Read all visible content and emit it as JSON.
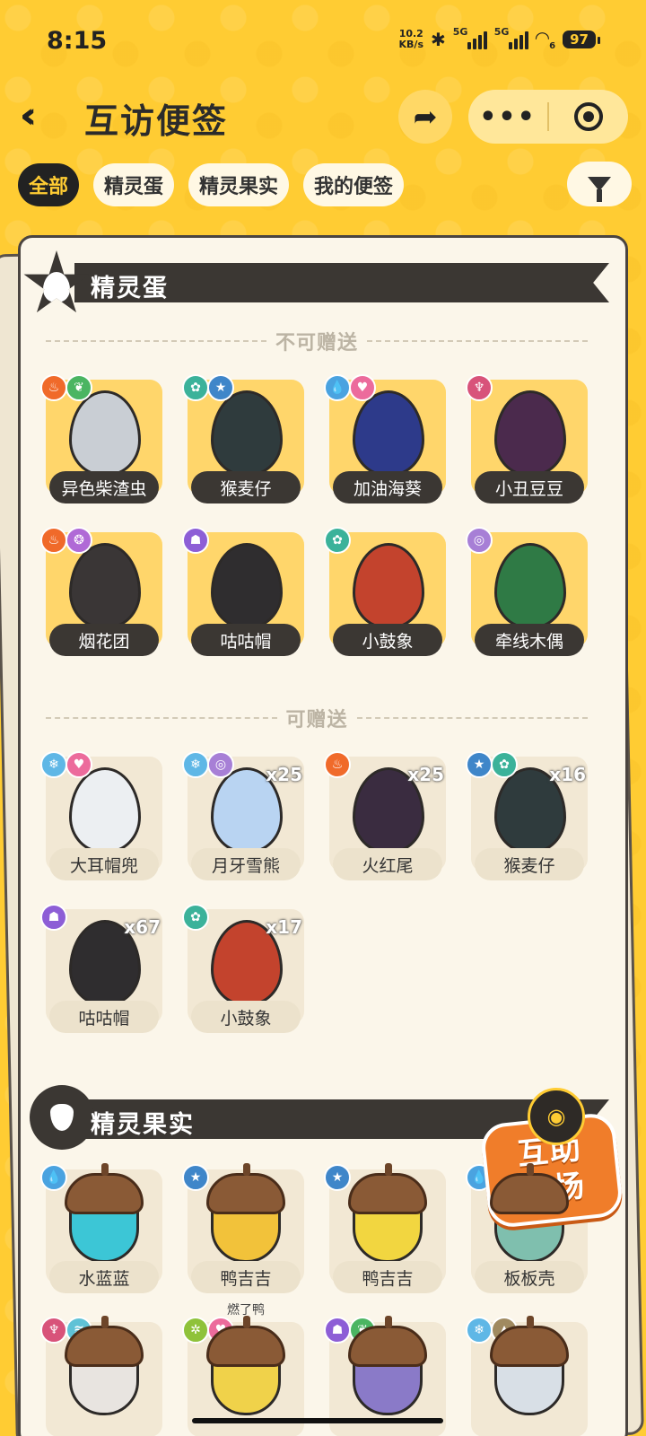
{
  "status_bar": {
    "time": "8:15",
    "net_speed_value": "10.2",
    "net_speed_unit": "KB/s",
    "network_1": "5G",
    "network_2": "5G",
    "wifi_sub": "6",
    "battery": "97"
  },
  "header": {
    "title": "互访便签",
    "back_icon": "double-chevron-left-icon",
    "share_icon": "share-arrow-icon",
    "more_label": "•••",
    "close_icon": "target-circle-icon"
  },
  "tabs": [
    {
      "label": "全部",
      "active": true
    },
    {
      "label": "精灵蛋",
      "active": false
    },
    {
      "label": "精灵果实",
      "active": false
    },
    {
      "label": "我的便签",
      "active": false
    }
  ],
  "filter_icon": "funnel-filter-icon",
  "sections": {
    "eggs": {
      "title": "精灵蛋",
      "non_giftable_label": "不可赠送",
      "giftable_label": "可赠送"
    },
    "fruits": {
      "title": "精灵果实"
    }
  },
  "eggs_not_giftable": [
    {
      "name": "异色柴渣虫",
      "badges": [
        {
          "icon": "fire",
          "color": "#f06a2a"
        },
        {
          "icon": "leaf",
          "color": "#4bb562"
        }
      ],
      "egg_color": "#c9ced4"
    },
    {
      "name": "猴麦仔",
      "badges": [
        {
          "icon": "gear",
          "color": "#3bb29a"
        },
        {
          "icon": "star",
          "color": "#3f86c9"
        }
      ],
      "egg_color": "#2f3b3d"
    },
    {
      "name": "加油海葵",
      "badges": [
        {
          "icon": "water",
          "color": "#4aa3e0"
        },
        {
          "icon": "heart",
          "color": "#ec6b9c"
        }
      ],
      "egg_color": "#2d3a8a"
    },
    {
      "name": "小丑豆豆",
      "badges": [
        {
          "icon": "demon",
          "color": "#d8537a"
        }
      ],
      "egg_color": "#4b2a4d"
    },
    {
      "name": "烟花团",
      "badges": [
        {
          "icon": "fire",
          "color": "#f06a2a"
        },
        {
          "icon": "poison",
          "color": "#b06ad6"
        }
      ],
      "egg_color": "#3a3636"
    },
    {
      "name": "咕咕帽",
      "badges": [
        {
          "icon": "ghost",
          "color": "#8d5ed6"
        }
      ],
      "egg_color": "#2f2d2f"
    },
    {
      "name": "小鼓象",
      "badges": [
        {
          "icon": "gear",
          "color": "#3bb29a"
        }
      ],
      "egg_color": "#c3432d"
    },
    {
      "name": "牵线木偶",
      "badges": [
        {
          "icon": "spiral",
          "color": "#a77fd6"
        }
      ],
      "egg_color": "#2f7a45"
    }
  ],
  "eggs_giftable": [
    {
      "name": "大耳帽兜",
      "badges": [
        {
          "icon": "ice",
          "color": "#5fb7e6"
        },
        {
          "icon": "heart",
          "color": "#ec6b9c"
        }
      ],
      "egg_color": "#eceff2",
      "count": ""
    },
    {
      "name": "月牙雪熊",
      "badges": [
        {
          "icon": "ice",
          "color": "#5fb7e6"
        },
        {
          "icon": "spiral",
          "color": "#a77fd6"
        }
      ],
      "egg_color": "#b9d4f2",
      "count": "x25"
    },
    {
      "name": "火红尾",
      "badges": [
        {
          "icon": "fire",
          "color": "#f06a2a"
        }
      ],
      "egg_color": "#3a2c40",
      "count": "x25"
    },
    {
      "name": "猴麦仔",
      "badges": [
        {
          "icon": "star",
          "color": "#3f86c9"
        },
        {
          "icon": "gear",
          "color": "#3bb29a"
        }
      ],
      "egg_color": "#2f3b3d",
      "count": "x16"
    },
    {
      "name": "咕咕帽",
      "badges": [
        {
          "icon": "ghost",
          "color": "#8d5ed6"
        }
      ],
      "egg_color": "#2f2d2f",
      "count": "x67"
    },
    {
      "name": "小鼓象",
      "badges": [
        {
          "icon": "gear",
          "color": "#3bb29a"
        }
      ],
      "egg_color": "#c3432d",
      "count": "x17"
    }
  ],
  "fruits": [
    {
      "name": "水蓝蓝",
      "badges": [
        {
          "icon": "water",
          "color": "#4aa3e0"
        }
      ],
      "body_color": "#3cc6d6",
      "note": ""
    },
    {
      "name": "鸭吉吉",
      "badges": [
        {
          "icon": "star",
          "color": "#3f86c9"
        }
      ],
      "body_color": "#f2c23a",
      "note": "燃了鸭"
    },
    {
      "name": "鸭吉吉",
      "badges": [
        {
          "icon": "star",
          "color": "#3f86c9"
        }
      ],
      "body_color": "#f2d640",
      "note": ""
    },
    {
      "name": "板板壳",
      "badges": [
        {
          "icon": "water",
          "color": "#4aa3e0"
        }
      ],
      "body_color": "#7fbfae",
      "note": ""
    },
    {
      "name": "",
      "badges": [
        {
          "icon": "demon",
          "color": "#d8537a"
        },
        {
          "icon": "wing",
          "color": "#5fc2d6"
        }
      ],
      "body_color": "#e8e4e0",
      "note": ""
    },
    {
      "name": "",
      "badges": [
        {
          "icon": "bug",
          "color": "#8fc23a"
        },
        {
          "icon": "heart",
          "color": "#ec6b9c"
        }
      ],
      "body_color": "#f0d24a",
      "note": ""
    },
    {
      "name": "",
      "badges": [
        {
          "icon": "ghost",
          "color": "#8d5ed6"
        },
        {
          "icon": "leaf",
          "color": "#4bb562"
        }
      ],
      "body_color": "#8a7ac8",
      "note": ""
    },
    {
      "name": "",
      "badges": [
        {
          "icon": "ice",
          "color": "#5fb7e6"
        },
        {
          "icon": "mountain",
          "color": "#a08a60"
        }
      ],
      "body_color": "#d8dfe6",
      "note": ""
    }
  ],
  "fab": {
    "line1": "互助",
    "line2": "广场",
    "icon": "mascot-face-icon"
  }
}
